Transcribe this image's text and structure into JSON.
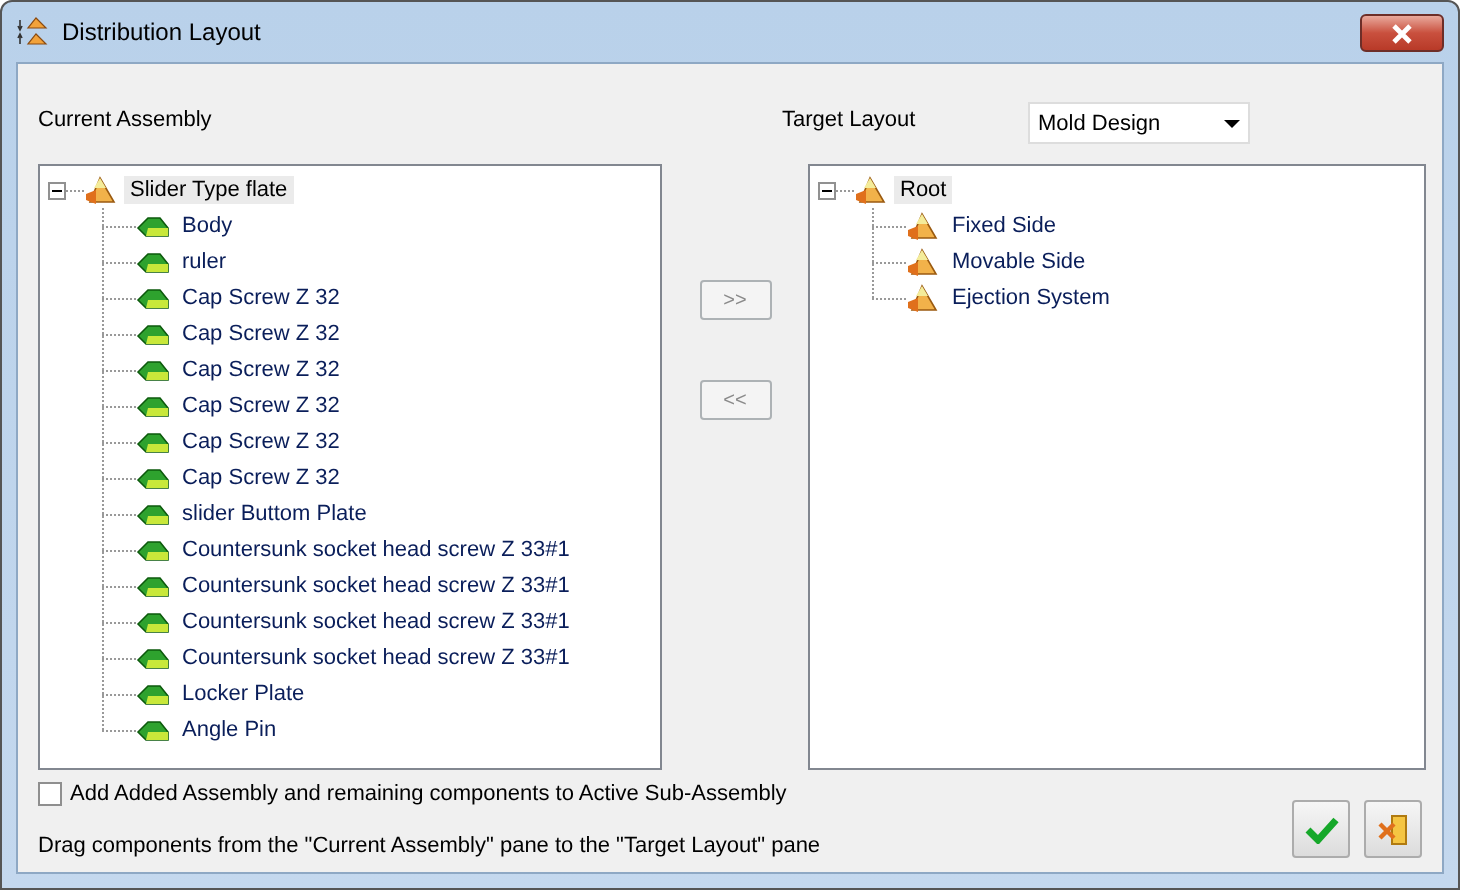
{
  "window": {
    "title": "Distribution Layout"
  },
  "current_assembly": {
    "label": "Current Assembly",
    "tree": [
      {
        "label": "Slider Type flate",
        "kind": "assembly",
        "expanded": true,
        "selected": true,
        "children": [
          {
            "label": "Body",
            "kind": "part"
          },
          {
            "label": "ruler",
            "kind": "part"
          },
          {
            "label": "Cap Screw Z 32",
            "kind": "part"
          },
          {
            "label": "Cap Screw Z 32",
            "kind": "part"
          },
          {
            "label": "Cap Screw Z 32",
            "kind": "part"
          },
          {
            "label": "Cap Screw Z 32",
            "kind": "part"
          },
          {
            "label": "Cap Screw Z 32",
            "kind": "part"
          },
          {
            "label": "Cap Screw Z 32",
            "kind": "part"
          },
          {
            "label": "slider Buttom Plate",
            "kind": "part"
          },
          {
            "label": "Countersunk socket head screw Z 33#1",
            "kind": "part"
          },
          {
            "label": "Countersunk socket head screw Z 33#1",
            "kind": "part"
          },
          {
            "label": "Countersunk socket head screw Z 33#1",
            "kind": "part"
          },
          {
            "label": "Countersunk socket head screw Z 33#1",
            "kind": "part"
          },
          {
            "label": "Locker Plate",
            "kind": "part"
          },
          {
            "label": "Angle Pin",
            "kind": "part"
          }
        ]
      }
    ]
  },
  "move_buttons": [
    {
      "label": ">>",
      "disabled": true
    },
    {
      "label": "<<",
      "disabled": true
    }
  ],
  "target_layout": {
    "label": "Target Layout",
    "dropdown": {
      "value": "Mold Design"
    },
    "tree": [
      {
        "label": "Root",
        "kind": "assembly",
        "expanded": true,
        "selected": true,
        "children": [
          {
            "label": "Fixed Side",
            "kind": "assembly"
          },
          {
            "label": "Movable Side",
            "kind": "assembly"
          },
          {
            "label": "Ejection System",
            "kind": "assembly"
          }
        ]
      }
    ]
  },
  "add_to_active": {
    "label": "Add Added Assembly and remaining components to Active Sub-Assembly",
    "checked": false
  },
  "hint": "Drag components from the \"Current Assembly\" pane to the \"Target Layout\" pane"
}
